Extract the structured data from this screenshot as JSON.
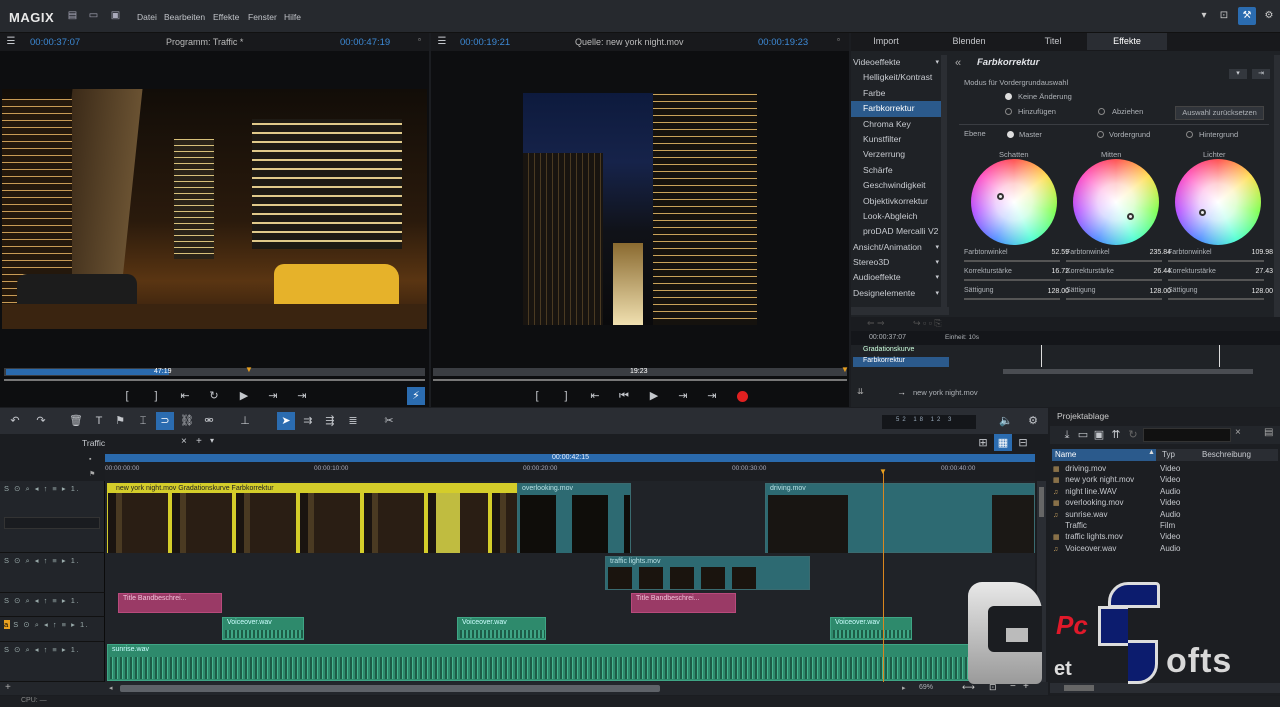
{
  "app": {
    "logo": "MAGIX",
    "menu": [
      "Datei",
      "Bearbeiten",
      "Effekte",
      "Fenster",
      "Hilfe"
    ]
  },
  "program_monitor": {
    "tc_left": "00:00:37:07",
    "title": "Programm: Traffic *",
    "tc_right": "00:00:47:19",
    "scrub_time": "47:19",
    "play_position": 0.39
  },
  "source_monitor": {
    "tc_left": "00:00:19:21",
    "title": "Quelle: new york night.mov",
    "tc_right": "00:00:19:23",
    "scrub_time": "19:23"
  },
  "transport": {
    "mark_in": "[",
    "mark_out": "]"
  },
  "tabs": [
    "Import",
    "Blenden",
    "Titel",
    "Effekte"
  ],
  "active_tab": "Effekte",
  "effects": {
    "header": "Farbkorrektur",
    "categories": [
      {
        "label": "Videoeffekte",
        "type": "cat"
      },
      {
        "label": "Helligkeit/Kontrast",
        "type": "item"
      },
      {
        "label": "Farbe",
        "type": "item"
      },
      {
        "label": "Farbkorrektur",
        "type": "item",
        "selected": true
      },
      {
        "label": "Chroma Key",
        "type": "item"
      },
      {
        "label": "Kunstfilter",
        "type": "item"
      },
      {
        "label": "Verzerrung",
        "type": "item"
      },
      {
        "label": "Schärfe",
        "type": "item"
      },
      {
        "label": "Geschwindigkeit",
        "type": "item"
      },
      {
        "label": "Objektivkorrektur",
        "type": "item"
      },
      {
        "label": "Look-Abgleich",
        "type": "item"
      },
      {
        "label": "proDAD Mercalli V2",
        "type": "item"
      },
      {
        "label": "Ansicht/Animation",
        "type": "cat"
      },
      {
        "label": "Stereo3D",
        "type": "cat"
      },
      {
        "label": "Audioeffekte",
        "type": "cat"
      },
      {
        "label": "Designelemente",
        "type": "cat"
      }
    ],
    "mode_label": "Modus für Vordergrundauswahl",
    "opt_none": "Keine Änderung",
    "opt_add": "Hinzufügen",
    "opt_sub": "Abziehen",
    "reset": "Auswahl zurücksetzen",
    "level_label": "Ebene",
    "levels": [
      "Master",
      "Vordergrund",
      "Hintergrund"
    ],
    "wheels": [
      {
        "name": "Schatten",
        "hue_label": "Farbtonwinkel",
        "hue": "52.59",
        "corr_label": "Korrekturstärke",
        "corr": "16.72",
        "sat_label": "Sättigung",
        "sat": "128.00"
      },
      {
        "name": "Mitten",
        "hue_label": "Farbtonwinkel",
        "hue": "235.84",
        "corr_label": "Korrekturstärke",
        "corr": "26.44",
        "sat_label": "Sättigung",
        "sat": "128.00"
      },
      {
        "name": "Lichter",
        "hue_label": "Farbtonwinkel",
        "hue": "109.98",
        "corr_label": "Korrekturstärke",
        "corr": "27.43",
        "sat_label": "Sättigung",
        "sat": "128.00"
      }
    ],
    "kf_time": "00:00:37:07",
    "kf_unit": "Einheit: 10s",
    "kf_rows": [
      "Gradationskurve",
      "Farbkorrektur"
    ],
    "clip_name": "new york night.mov"
  },
  "timeline": {
    "tab": "Traffic",
    "ruler": [
      "00:00:00:00",
      "00:00:10:00",
      "00:00:20:00",
      "00:00:30:00",
      "00:00:40:00"
    ],
    "playhead_tc": "00:00:42:15",
    "track_head": "S ⊙ ⌕ ◂ ↑ ≡ ▸ 1.",
    "meter": [
      "52",
      "18",
      "12",
      "3"
    ],
    "clips": {
      "c1": "new york night.mov  Gradationskurve  Farbkorrektur",
      "c2": "overlooking.mov",
      "c3": "driving.mov",
      "c4": "traffic lights.mov",
      "c5": "Title  Bandbeschrei...",
      "c6": "Title  Bandbeschrei...",
      "c7": "Voiceover.wav",
      "c8": "Voiceover.wav",
      "c9": "Voiceover.wav",
      "c10": "sunrise.wav"
    },
    "zoom": "69%"
  },
  "project": {
    "title": "Projektablage",
    "cols": [
      "Name",
      "Typ",
      "Beschreibung"
    ],
    "rows": [
      {
        "name": "driving.mov",
        "type": "Video",
        "icon": "film"
      },
      {
        "name": "new york night.mov",
        "type": "Video",
        "icon": "film"
      },
      {
        "name": "night line.WAV",
        "type": "Audio",
        "icon": "note"
      },
      {
        "name": "overlooking.mov",
        "type": "Video",
        "icon": "film"
      },
      {
        "name": "sunrise.wav",
        "type": "Audio",
        "icon": "note"
      },
      {
        "name": "Traffic",
        "type": "Film",
        "icon": "none"
      },
      {
        "name": "traffic lights.mov",
        "type": "Video",
        "icon": "film"
      },
      {
        "name": "Voiceover.wav",
        "type": "Audio",
        "icon": "note"
      }
    ]
  },
  "status": {
    "cpu": "CPU: —"
  },
  "watermark": {
    "pc": "Pc",
    "et": "et",
    "ofts": "ofts"
  },
  "colors": {
    "accent": "#3d8ad6",
    "clip_teal": "#2d6a72",
    "clip_yellow": "#d4cd2a",
    "title_pink": "#9a3a66",
    "audio_green": "#2e8a6c",
    "record": "#e02020"
  }
}
